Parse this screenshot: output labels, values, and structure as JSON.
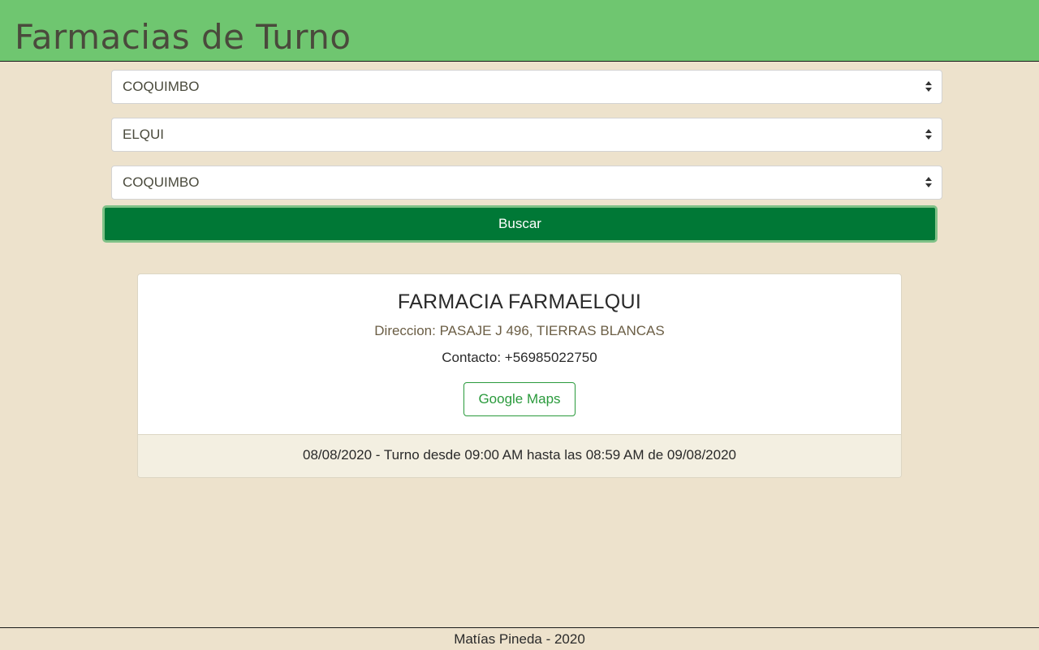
{
  "header": {
    "title": "Farmacias de Turno"
  },
  "filters": {
    "region": "COQUIMBO",
    "province": "ELQUI",
    "commune": "COQUIMBO"
  },
  "search": {
    "label": "Buscar"
  },
  "result": {
    "name": "FARMACIA FARMAELQUI",
    "address": "Direccion: PASAJE J 496, TIERRAS BLANCAS",
    "contact": "Contacto: +56985022750",
    "maps_label": "Google Maps",
    "schedule": "08/08/2020 - Turno desde 09:00 AM hasta las 08:59 AM de 09/08/2020"
  },
  "footer": {
    "text": "Matías Pineda - 2020"
  },
  "colors": {
    "header_bg": "#6fc670",
    "page_bg": "#ede2cc",
    "primary_button": "#007836",
    "maps_outline": "#2a9a3c"
  }
}
